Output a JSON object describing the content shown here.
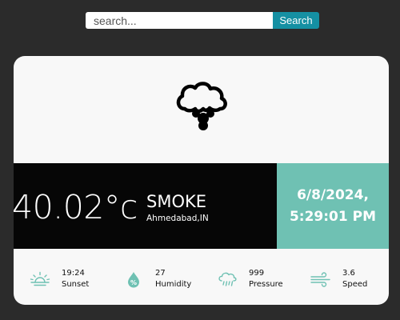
{
  "search": {
    "placeholder": "search...",
    "value": "",
    "button_label": "Search"
  },
  "weather": {
    "icon": "cloud-icon",
    "temperature": "40.02°c",
    "condition": "SMOKE",
    "location": "Ahmedabad,IN"
  },
  "datetime": {
    "date": "6/8/2024,",
    "time": "5:29:01 PM"
  },
  "stats": {
    "sunset": {
      "value": "19:24",
      "label": "Sunset",
      "icon": "sunset-icon"
    },
    "humidity": {
      "value": "27",
      "label": "Humidity",
      "icon": "humidity-icon"
    },
    "pressure": {
      "value": "999",
      "label": "Pressure",
      "icon": "pressure-icon"
    },
    "speed": {
      "value": "3.6",
      "label": "Speed",
      "icon": "wind-icon"
    }
  },
  "colors": {
    "background": "#2b2b2b",
    "card": "#f8f8f8",
    "band_dark": "#060606",
    "accent_teal": "#6fc1b3",
    "search_button": "#1590a3"
  }
}
